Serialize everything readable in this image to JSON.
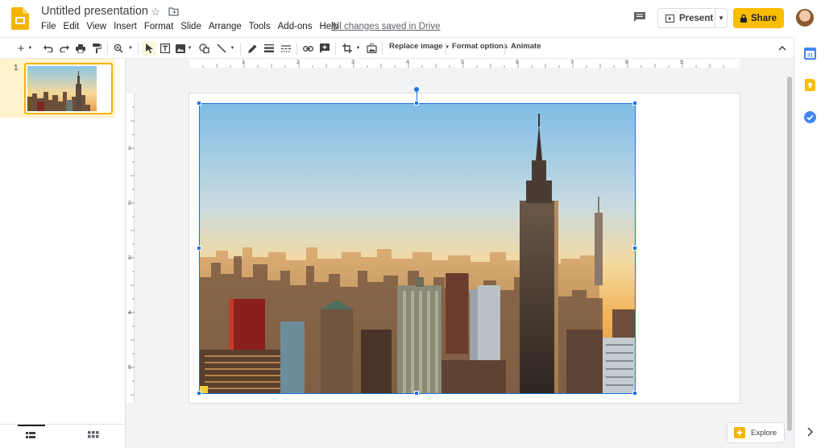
{
  "header": {
    "title": "Untitled presentation",
    "saved_status": "All changes saved in Drive",
    "menu": [
      "File",
      "Edit",
      "View",
      "Insert",
      "Format",
      "Slide",
      "Arrange",
      "Tools",
      "Add-ons",
      "Help"
    ],
    "present_label": "Present",
    "share_label": "Share"
  },
  "toolbar": {
    "replace_image_label": "Replace image",
    "format_options_label": "Format options",
    "animate_label": "Animate"
  },
  "filmstrip": {
    "slides": [
      {
        "number": "1"
      }
    ]
  },
  "rulers": {
    "horizontal": [
      "1",
      "2",
      "3",
      "4",
      "5",
      "6",
      "7",
      "8",
      "9"
    ],
    "vertical": [
      "1",
      "2",
      "3",
      "4",
      "5"
    ]
  },
  "explore": {
    "label": "Explore"
  },
  "colors": {
    "accent": "#fbbc04",
    "selection": "#1a73e8",
    "app_yellow": "#f4b400"
  }
}
